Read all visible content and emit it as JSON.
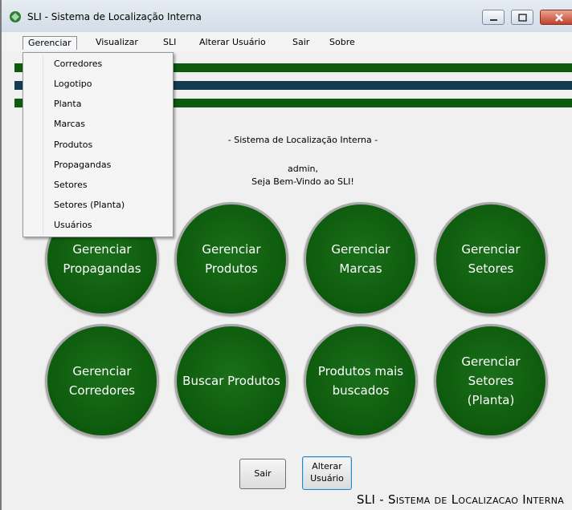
{
  "window": {
    "title": "SLI - Sistema de Localização Interna"
  },
  "menubar": {
    "items": [
      {
        "label": "Gerenciar"
      },
      {
        "label": "Visualizar"
      },
      {
        "label": "SLI"
      },
      {
        "label": "Alterar Usuário"
      },
      {
        "label": "Sair"
      },
      {
        "label": "Sobre"
      }
    ],
    "open_menu": {
      "items": [
        {
          "label": "Corredores"
        },
        {
          "label": "Logotipo"
        },
        {
          "label": "Planta"
        },
        {
          "label": "Marcas"
        },
        {
          "label": "Produtos"
        },
        {
          "label": "Propagandas"
        },
        {
          "label": "Setores"
        },
        {
          "label": "Setores (Planta)"
        },
        {
          "label": "Usuários"
        }
      ]
    }
  },
  "main": {
    "heading": "- Sistema de Localização Interna -",
    "user": "admin,",
    "welcome": "Seja Bem-Vindo ao SLI!",
    "tiles": [
      {
        "label": "Gerenciar\nPropagandas"
      },
      {
        "label": "Gerenciar\nProdutos"
      },
      {
        "label": "Gerenciar\nMarcas"
      },
      {
        "label": "Gerenciar\nSetores"
      },
      {
        "label": "Gerenciar\nCorredores"
      },
      {
        "label": "Buscar Produtos"
      },
      {
        "label": "Produtos mais\nbuscados"
      },
      {
        "label": "Gerenciar\nSetores\n(Planta)"
      }
    ]
  },
  "buttons": {
    "sair": "Sair",
    "alterar_line1": "Alterar",
    "alterar_line2": "Usuário"
  },
  "footer": {
    "text": "SLI - Sistema de Localizacao Interna"
  },
  "colors": {
    "stripe_green": "#0e5a0e",
    "stripe_navy": "#143c50",
    "tile_green": "#0d5a0d"
  }
}
